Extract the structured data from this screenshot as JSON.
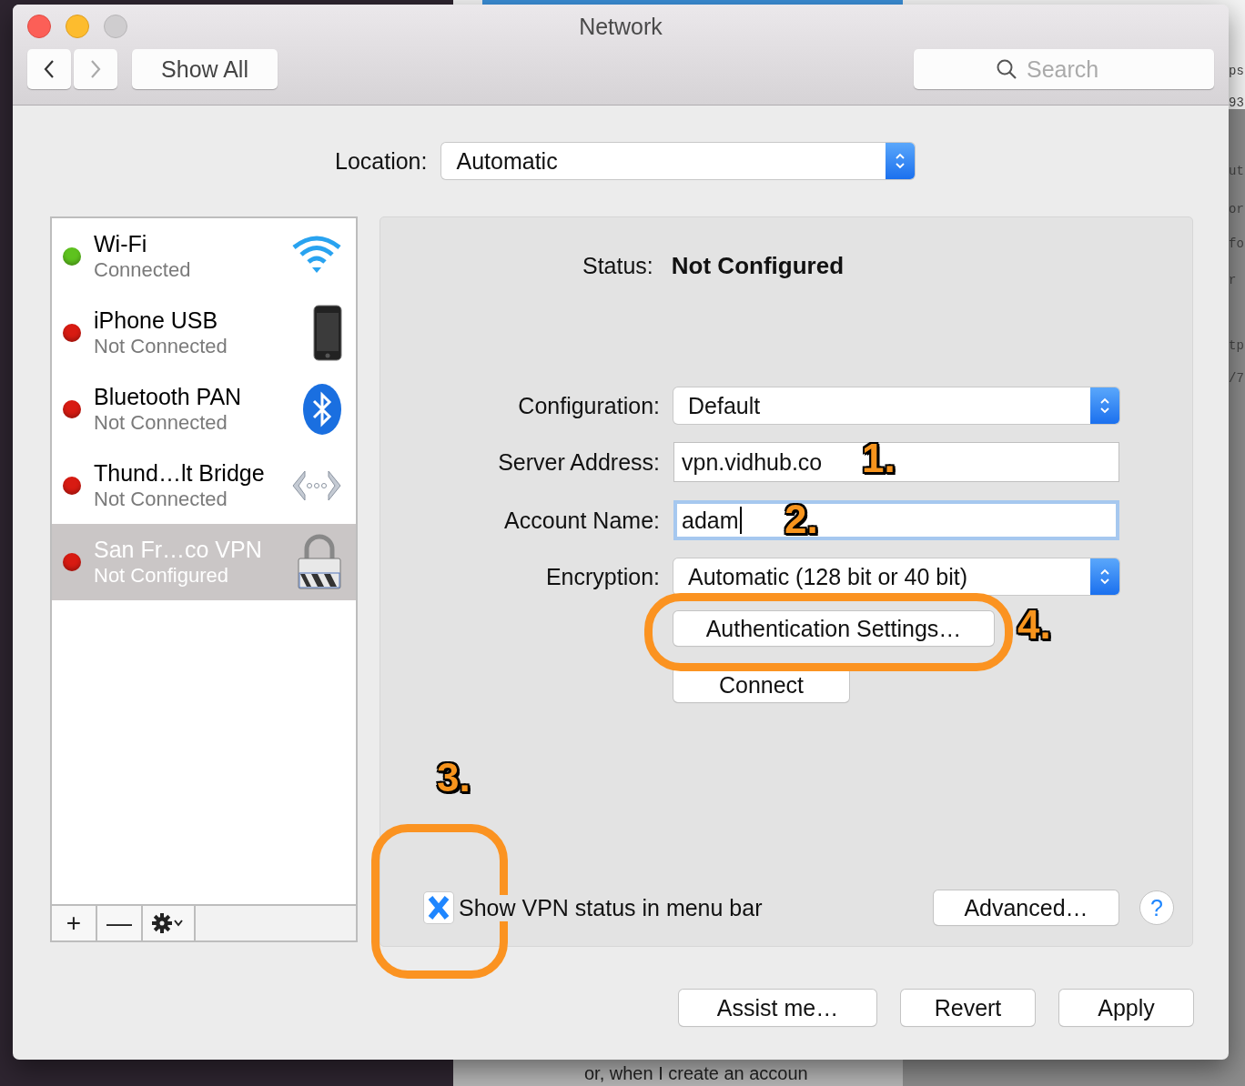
{
  "backdrop": {
    "bottom_text": "or, when I create an accoun",
    "edge_texts": [
      "ps",
      "93",
      "ut",
      "or",
      "fo",
      "r",
      "tp",
      "/7"
    ]
  },
  "window": {
    "title": "Network"
  },
  "toolbar": {
    "back": {
      "disabled": false
    },
    "forward": {
      "disabled": true
    },
    "show_all": "Show All",
    "search": {
      "placeholder": "Search"
    }
  },
  "location": {
    "label": "Location:",
    "value": "Automatic"
  },
  "services": [
    {
      "name": "Wi-Fi",
      "status": "Connected",
      "color": "#5ec21e",
      "kind": "wifi",
      "selected": false
    },
    {
      "name": "iPhone USB",
      "status": "Not Connected",
      "color": "#d81b12",
      "kind": "phone",
      "selected": false
    },
    {
      "name": "Bluetooth PAN",
      "status": "Not Connected",
      "color": "#d81b12",
      "kind": "bluetooth",
      "selected": false
    },
    {
      "name": "Thund…lt Bridge",
      "status": "Not Connected",
      "color": "#d81b12",
      "kind": "bridge",
      "selected": false
    },
    {
      "name": "San Fr…co VPN",
      "status": "Not Configured",
      "color": "#d81b12",
      "kind": "vpn",
      "selected": true
    }
  ],
  "sidebar_buttons": {
    "add": "+",
    "remove": "—"
  },
  "detail": {
    "status_label": "Status:",
    "status_value": "Not Configured",
    "fields": [
      {
        "kind": "popup",
        "label": "Configuration:",
        "value": "Default"
      },
      {
        "kind": "text",
        "label": "Server Address:",
        "value": "vpn.vidhub.co",
        "focused": false
      },
      {
        "kind": "text",
        "label": "Account Name:",
        "value": "adam",
        "focused": true
      },
      {
        "kind": "popup",
        "label": "Encryption:",
        "value": "Automatic (128 bit or 40 bit)"
      }
    ],
    "auth_button": "Authentication Settings…",
    "connect_button": "Connect",
    "show_status": {
      "label": "Show VPN status in menu bar",
      "checked": true
    },
    "advanced_button": "Advanced…",
    "help_button": "?"
  },
  "footer_buttons": [
    "Assist me…",
    "Revert",
    "Apply"
  ],
  "annotations": [
    {
      "kind": "number",
      "text": "1."
    },
    {
      "kind": "number",
      "text": "2."
    },
    {
      "kind": "number",
      "text": "3."
    },
    {
      "kind": "number",
      "text": "4."
    },
    {
      "kind": "ring"
    },
    {
      "kind": "ring"
    }
  ]
}
